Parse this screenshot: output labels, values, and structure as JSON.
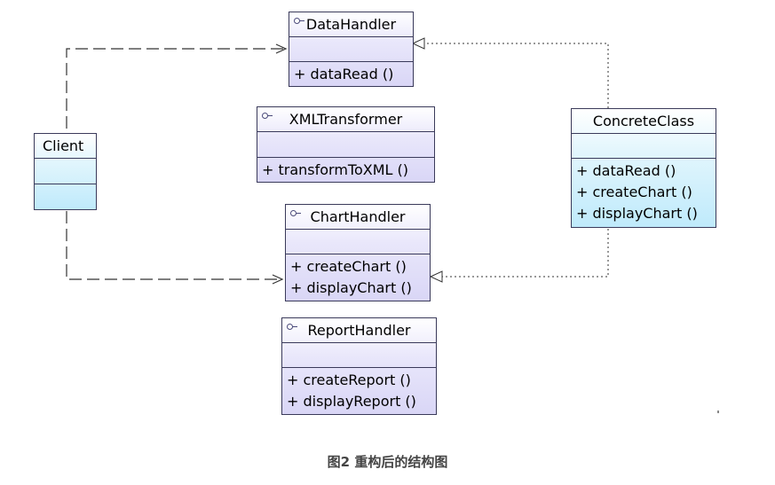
{
  "diagram": {
    "classes": {
      "data_handler": {
        "name": "DataHandler",
        "operations": [
          "+ dataRead ()"
        ]
      },
      "xml_transformer": {
        "name": "XMLTransformer",
        "operations": [
          "+ transformToXML ()"
        ]
      },
      "chart_handler": {
        "name": "ChartHandler",
        "operations": [
          "+ createChart ()",
          "+ displayChart ()"
        ]
      },
      "report_handler": {
        "name": "ReportHandler",
        "operations": [
          "+ createReport ()",
          "+ displayReport ()"
        ]
      },
      "client": {
        "name": "Client",
        "operations": []
      },
      "concrete_class": {
        "name": "ConcreteClass",
        "operations": [
          "+ dataRead ()",
          "+ createChart ()",
          "+ displayChart ()"
        ]
      }
    },
    "relations": [
      {
        "type": "dependency",
        "from": "Client",
        "to": "DataHandler"
      },
      {
        "type": "dependency",
        "from": "Client",
        "to": "ChartHandler"
      },
      {
        "type": "realization",
        "from": "ConcreteClass",
        "to": "DataHandler"
      },
      {
        "type": "realization",
        "from": "ConcreteClass",
        "to": "ChartHandler"
      }
    ],
    "colors": {
      "interface_fill": "#d9d6f6",
      "class_fill": "#bfeafb",
      "line": "#3a3a5a"
    },
    "icons": {
      "interface_stereotype": "interface-lollipop-icon"
    }
  },
  "caption": "图2 重构后的结构图"
}
